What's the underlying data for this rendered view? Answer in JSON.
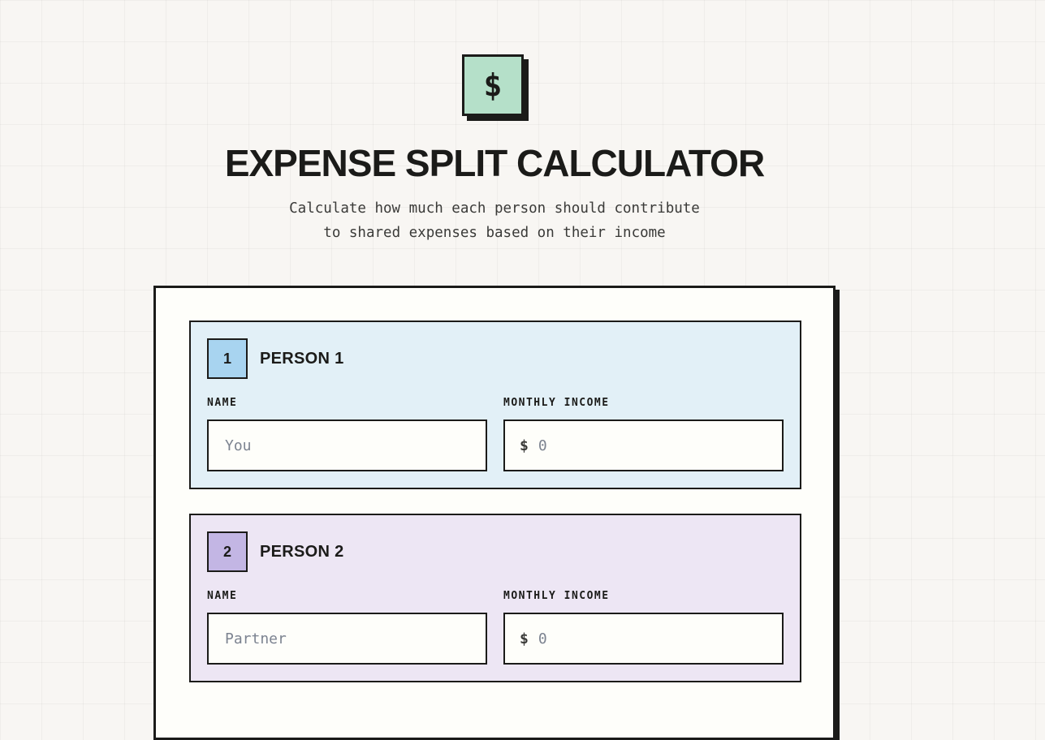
{
  "logo": {
    "symbol": "$",
    "color": "#b5e0c9"
  },
  "header": {
    "title": "EXPENSE SPLIT CALCULATOR",
    "subtitle_line1": "Calculate how much each person should contribute",
    "subtitle_line2": "to shared expenses based on their income"
  },
  "persons": [
    {
      "number": "1",
      "title": "PERSON 1",
      "name_label": "NAME",
      "name_placeholder": "You",
      "name_value": "",
      "income_label": "MONTHLY INCOME",
      "currency": "$",
      "income_placeholder": "0",
      "income_value": "",
      "color": "#a8d4f0"
    },
    {
      "number": "2",
      "title": "PERSON 2",
      "name_label": "NAME",
      "name_placeholder": "Partner",
      "name_value": "",
      "income_label": "MONTHLY INCOME",
      "currency": "$",
      "income_placeholder": "0",
      "income_value": "",
      "color": "#c3b6e4"
    }
  ]
}
